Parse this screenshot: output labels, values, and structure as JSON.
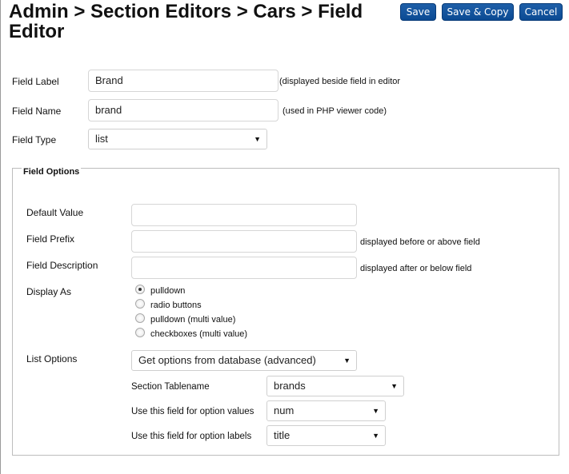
{
  "header": {
    "title": "Admin > Section Editors > Cars > Field Editor",
    "buttons": {
      "save": "Save",
      "save_copy": "Save & Copy",
      "cancel": "Cancel"
    }
  },
  "fields": {
    "field_label": {
      "label": "Field Label",
      "value": "Brand",
      "hint": "(displayed beside field in editor"
    },
    "field_name": {
      "label": "Field Name",
      "value": "brand",
      "hint": "(used in PHP viewer code)"
    },
    "field_type": {
      "label": "Field Type",
      "value": "list"
    }
  },
  "field_options": {
    "legend": "Field Options",
    "default_value": {
      "label": "Default Value",
      "value": ""
    },
    "field_prefix": {
      "label": "Field Prefix",
      "value": "",
      "hint": "displayed before or above field"
    },
    "field_description": {
      "label": "Field Description",
      "value": "",
      "hint": "displayed after or below field"
    },
    "display_as": {
      "label": "Display As",
      "options": [
        "pulldown",
        "radio buttons",
        "pulldown (multi value)",
        "checkboxes (multi value)"
      ],
      "selected": "pulldown"
    },
    "list_options": {
      "label": "List Options",
      "value": "Get options from database (advanced)",
      "section_tablename": {
        "label": "Section Tablename",
        "value": "brands"
      },
      "option_values": {
        "label": "Use this field for option values",
        "value": "num"
      },
      "option_labels": {
        "label": "Use this field for option labels",
        "value": "title"
      }
    }
  },
  "icons": {
    "select_caret": "caret-down-icon",
    "radio": "radio-icon"
  },
  "colors": {
    "button_blue": "#0b4a93",
    "border": "#d6d6d6"
  }
}
